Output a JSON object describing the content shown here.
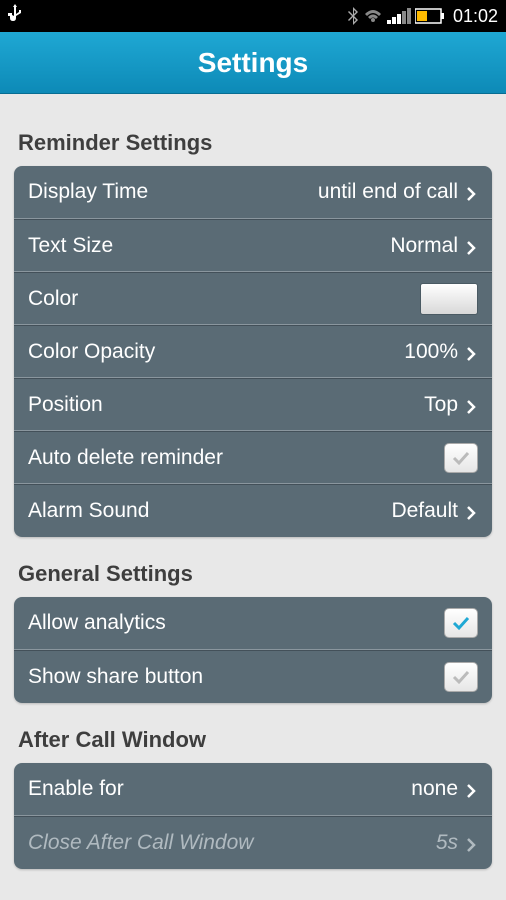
{
  "status": {
    "time": "01:02"
  },
  "header": {
    "title": "Settings"
  },
  "sections": {
    "reminder": {
      "title": "Reminder Settings",
      "display_time": {
        "label": "Display Time",
        "value": "until end of call"
      },
      "text_size": {
        "label": "Text Size",
        "value": "Normal"
      },
      "color": {
        "label": "Color"
      },
      "color_opacity": {
        "label": "Color Opacity",
        "value": "100%"
      },
      "position": {
        "label": "Position",
        "value": "Top"
      },
      "auto_delete": {
        "label": "Auto delete reminder",
        "checked": true
      },
      "alarm_sound": {
        "label": "Alarm Sound",
        "value": "Default"
      }
    },
    "general": {
      "title": "General Settings",
      "allow_analytics": {
        "label": "Allow analytics",
        "checked": true
      },
      "show_share": {
        "label": "Show share button",
        "checked": true
      }
    },
    "after_call": {
      "title": "After Call Window",
      "enable_for": {
        "label": "Enable for",
        "value": "none"
      },
      "close_after": {
        "label": "Close After Call Window",
        "value": "5s"
      }
    }
  }
}
